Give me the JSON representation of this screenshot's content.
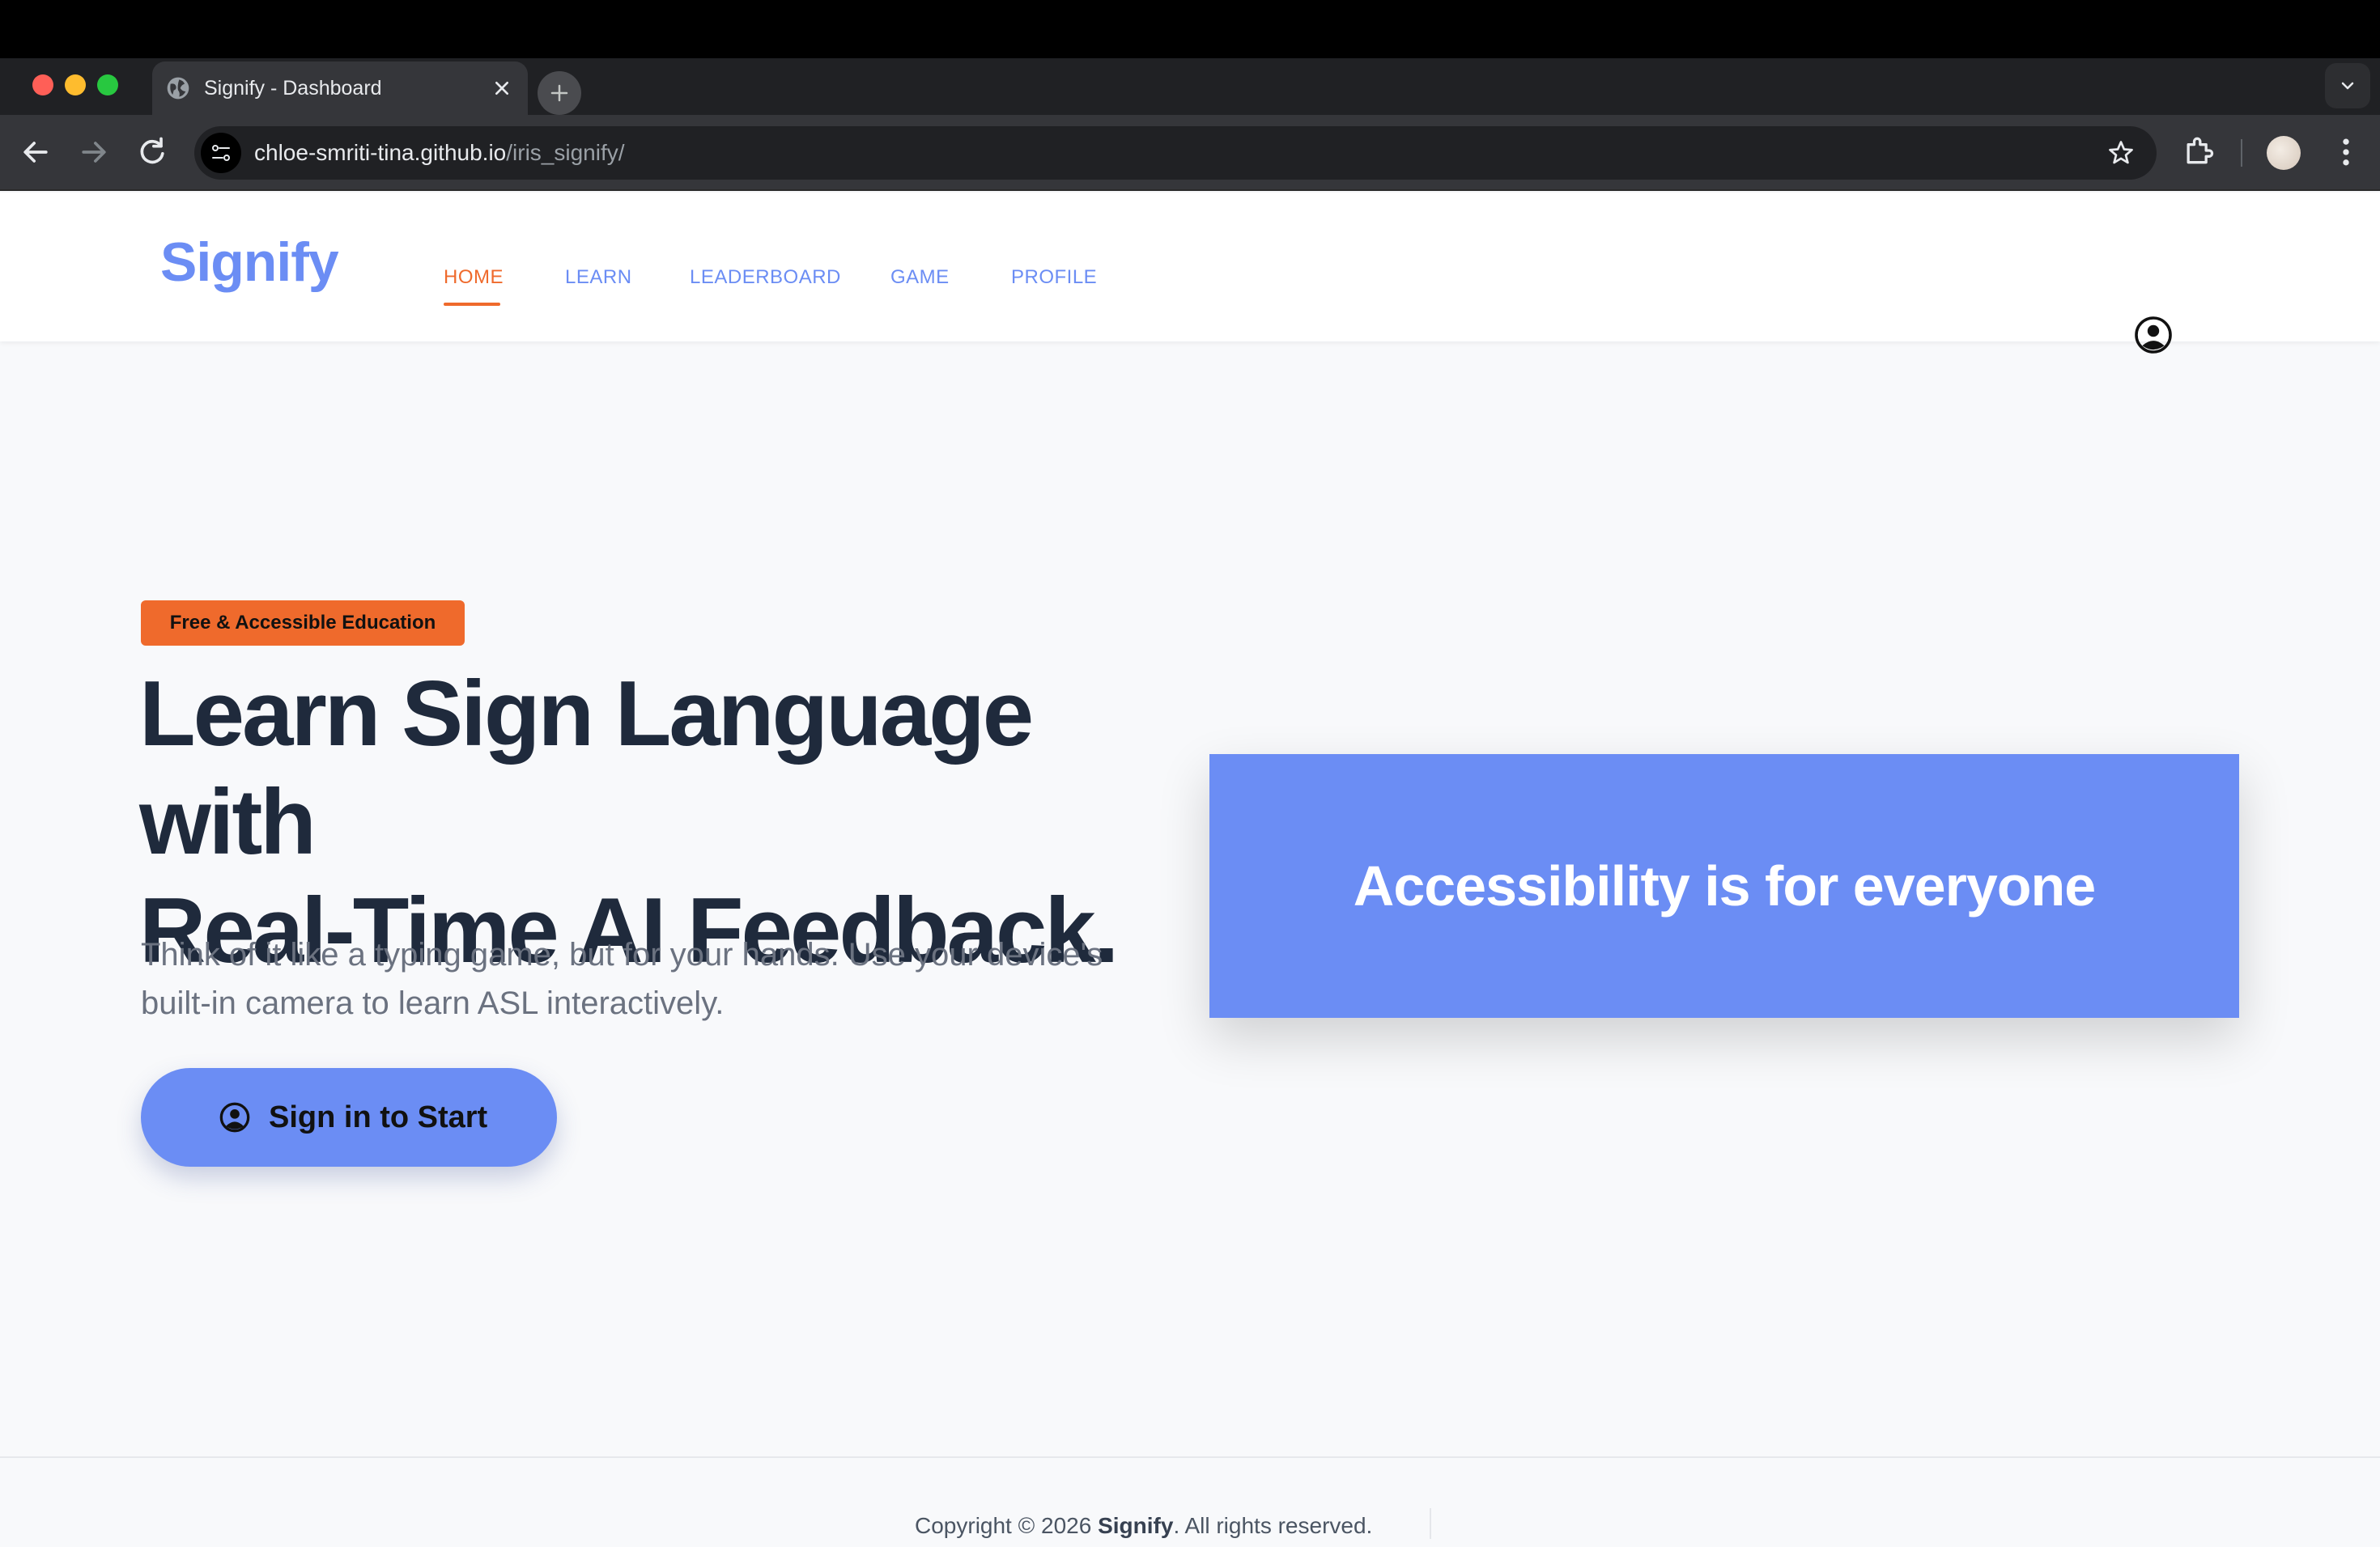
{
  "browser": {
    "tab_title": "Signify - Dashboard",
    "url_host": "chloe-smriti-tina.github.io",
    "url_path": "/iris_signify/"
  },
  "site": {
    "logo": "Signify",
    "nav": [
      {
        "label": "HOME",
        "active": true
      },
      {
        "label": "LEARN",
        "active": false
      },
      {
        "label": "LEADERBOARD",
        "active": false
      },
      {
        "label": "GAME",
        "active": false
      },
      {
        "label": "PROFILE",
        "active": false
      }
    ]
  },
  "hero": {
    "badge": "Free & Accessible Education",
    "title_line1": "Learn Sign Language with",
    "title_line2": "Real-Time AI Feedback.",
    "subtitle_line1": "Think of it like a typing game, but for your hands. Use your device's",
    "subtitle_line2": "built-in camera to learn ASL interactively.",
    "cta_label": "Sign in to Start"
  },
  "feature_card": {
    "text": "Accessibility is for everyone"
  },
  "footer": {
    "prefix": "Copyright © 2026 ",
    "brand": "Signify",
    "suffix": ". All rights reserved."
  },
  "colors": {
    "accent": "#6b8df4",
    "orange": "#ef6a2c",
    "heading": "#1f2a3c",
    "muted": "#6b7280"
  }
}
